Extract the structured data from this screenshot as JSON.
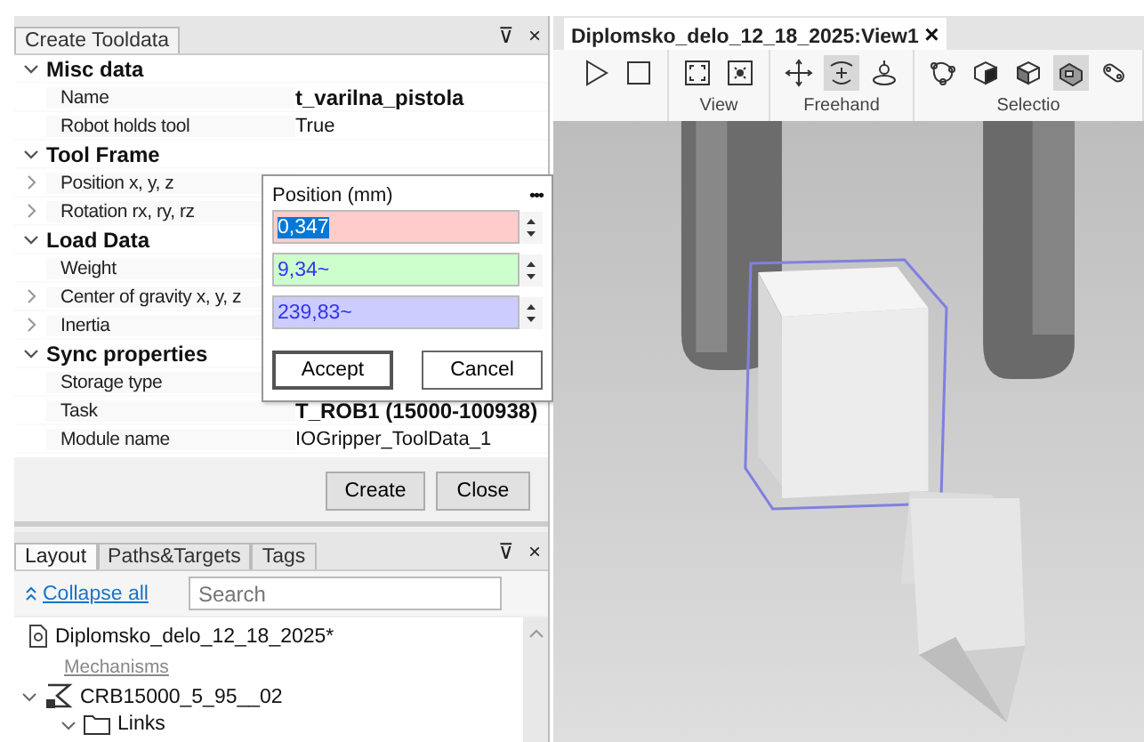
{
  "tool_panel": {
    "title": "Create Tooldata",
    "pin": "⊽",
    "close": "×",
    "groups": [
      {
        "label": "Misc data",
        "expanded": true,
        "items": [
          {
            "label": "Name",
            "value": "t_varilna_pistola",
            "bold": true,
            "expandable": false
          },
          {
            "label": "Robot holds tool",
            "value": "True",
            "bold": false,
            "expandable": false
          }
        ]
      },
      {
        "label": "Tool Frame",
        "expanded": true,
        "items": [
          {
            "label": "Position x, y, z",
            "expandable": true
          },
          {
            "label": "Rotation rx, ry, rz",
            "expandable": true
          }
        ]
      },
      {
        "label": "Load Data",
        "expanded": true,
        "items": [
          {
            "label": "Weight",
            "expandable": false
          },
          {
            "label": "Center of gravity x, y, z",
            "expandable": true
          },
          {
            "label": "Inertia",
            "expandable": true
          }
        ]
      },
      {
        "label": "Sync properties",
        "expanded": true,
        "items": [
          {
            "label": "Storage type",
            "expandable": false
          },
          {
            "label": "Task",
            "value": "T_ROB1 (15000-100938)",
            "bold": true,
            "expandable": false
          },
          {
            "label": "Module name",
            "value": "IOGripper_ToolData_1",
            "bold": false,
            "expandable": false
          }
        ]
      }
    ],
    "buttons": [
      "Create",
      "Close"
    ]
  },
  "popup": {
    "title": "Position (mm)",
    "menu": "•••",
    "fields": [
      {
        "value": "0,347",
        "color": "#ffcccc",
        "selected": true
      },
      {
        "value": "9,34~",
        "color": "#ccffcc",
        "selected": false
      },
      {
        "value": "239,83~",
        "color": "#ccccff",
        "selected": false
      }
    ],
    "buttons": [
      {
        "label": "Accept",
        "default": true
      },
      {
        "label": "Cancel",
        "default": false
      }
    ]
  },
  "layout_panel": {
    "tabs": [
      {
        "label": "Layout",
        "selected": true
      },
      {
        "label": "Paths&Targets",
        "selected": false
      },
      {
        "label": "Tags",
        "selected": false
      }
    ],
    "pin": "⊽",
    "close": "×",
    "collapse_link": "Collapse all",
    "search": {
      "placeholder": "Search"
    },
    "tree": [
      {
        "label": "Diplomsko_delo_12_18_2025*",
        "kind": "station"
      },
      {
        "label": "Mechanisms",
        "kind": "category"
      },
      {
        "label": "CRB15000_5_95__02",
        "kind": "robot",
        "expanded": true,
        "children": [
          {
            "label": "Links",
            "kind": "folder",
            "expanded": true
          }
        ]
      }
    ]
  },
  "view": {
    "tab": {
      "label": "Diplomsko_delo_12_18_2025:View1",
      "close": "×"
    },
    "toolbar": [
      {
        "tools": [
          {
            "kind": "play",
            "selected": false
          },
          {
            "kind": "stop",
            "selected": false
          }
        ]
      },
      {
        "label": "View",
        "tools": [
          {
            "kind": "frame",
            "selected": false
          },
          {
            "kind": "center",
            "selected": false
          }
        ]
      },
      {
        "label": "Freehand",
        "tools": [
          {
            "kind": "move",
            "selected": false
          },
          {
            "kind": "rotate",
            "selected": true
          },
          {
            "kind": "jog",
            "selected": false
          }
        ]
      },
      {
        "label": "Selectio",
        "tools": [
          {
            "kind": "curve",
            "selected": false
          },
          {
            "kind": "solid",
            "selected": false
          },
          {
            "kind": "cube",
            "selected": false
          },
          {
            "kind": "part",
            "selected": true
          },
          {
            "kind": "link",
            "selected": false
          }
        ]
      }
    ]
  }
}
